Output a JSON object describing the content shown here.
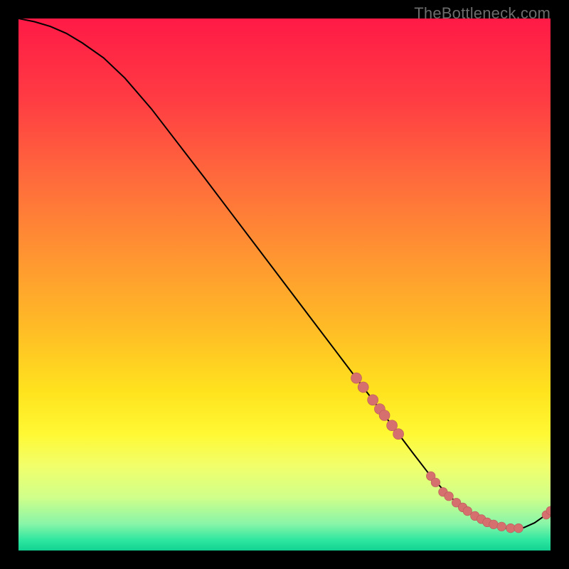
{
  "watermark": "TheBottleneck.com",
  "colors": {
    "curve": "#000000",
    "marker_fill": "#d6706e",
    "marker_stroke": "#b85a58",
    "end_marker": "#d6706e"
  },
  "chart_data": {
    "type": "line",
    "title": "",
    "xlabel": "",
    "ylabel": "",
    "xlim": [
      0,
      100
    ],
    "ylim": [
      0,
      100
    ],
    "grid": false,
    "series": [
      {
        "name": "bottleneck-curve",
        "x": [
          0,
          3,
          6,
          9,
          12,
          16,
          20,
          25,
          30,
          35,
          40,
          45,
          50,
          55,
          60,
          65,
          70,
          74,
          77,
          80,
          83,
          86,
          89,
          92,
          95,
          97,
          99,
          100
        ],
        "y": [
          100,
          99.4,
          98.5,
          97.2,
          95.4,
          92.6,
          88.8,
          83.0,
          76.5,
          70.0,
          63.4,
          56.8,
          50.2,
          43.6,
          37.0,
          30.4,
          23.8,
          18.5,
          14.6,
          11.2,
          8.4,
          6.2,
          4.8,
          4.1,
          4.3,
          5.2,
          6.6,
          7.5
        ]
      }
    ],
    "markers_upper": [
      {
        "x": 63.5,
        "y": 32.4
      },
      {
        "x": 64.8,
        "y": 30.7
      },
      {
        "x": 66.6,
        "y": 28.3
      },
      {
        "x": 67.9,
        "y": 26.6
      },
      {
        "x": 68.8,
        "y": 25.4
      },
      {
        "x": 70.2,
        "y": 23.5
      },
      {
        "x": 71.4,
        "y": 21.9
      }
    ],
    "markers_lower": [
      {
        "x": 77.5,
        "y": 14.0
      },
      {
        "x": 78.4,
        "y": 12.8
      },
      {
        "x": 79.8,
        "y": 11.0
      },
      {
        "x": 80.9,
        "y": 10.2
      },
      {
        "x": 82.3,
        "y": 9.0
      },
      {
        "x": 83.5,
        "y": 8.1
      },
      {
        "x": 84.4,
        "y": 7.4
      },
      {
        "x": 85.8,
        "y": 6.5
      },
      {
        "x": 87.0,
        "y": 5.9
      },
      {
        "x": 88.1,
        "y": 5.3
      },
      {
        "x": 89.3,
        "y": 4.9
      },
      {
        "x": 90.8,
        "y": 4.5
      },
      {
        "x": 92.5,
        "y": 4.2
      },
      {
        "x": 94.0,
        "y": 4.2
      }
    ],
    "end_markers": [
      {
        "x": 99.2,
        "y": 6.7
      },
      {
        "x": 100.0,
        "y": 7.5
      }
    ]
  }
}
